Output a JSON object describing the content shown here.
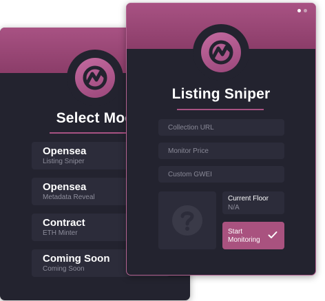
{
  "colors": {
    "accent": "#a85283",
    "card_background": "#23232f",
    "field_background": "#2c2c3a"
  },
  "select_mode_panel": {
    "logo_icon": "mountain-chart-logo-icon",
    "title": "Select Mod",
    "modes": [
      {
        "title": "Opensea",
        "subtitle": "Listing Sniper"
      },
      {
        "title": "Opensea",
        "subtitle": "Metadata Reveal"
      },
      {
        "title": "Contract",
        "subtitle": "ETH Minter"
      },
      {
        "title": "Coming Soon",
        "subtitle": "Coming Soon"
      }
    ]
  },
  "listing_sniper_panel": {
    "logo_icon": "mountain-chart-logo-icon",
    "title": "Listing Sniper",
    "page_indicator": {
      "total": 2,
      "active": 1
    },
    "fields": {
      "collection_url": {
        "placeholder": "Collection URL",
        "value": ""
      },
      "monitor_price": {
        "placeholder": "Monitor Price",
        "value": ""
      },
      "custom_gwei": {
        "placeholder": "Custom GWEI",
        "value": ""
      }
    },
    "nft_image_icon": "question-mark-icon",
    "current_floor": {
      "label": "Current Floor",
      "value": "N/A"
    },
    "start_button": {
      "label": "Start Monitoring",
      "icon": "checkmark-icon"
    }
  }
}
